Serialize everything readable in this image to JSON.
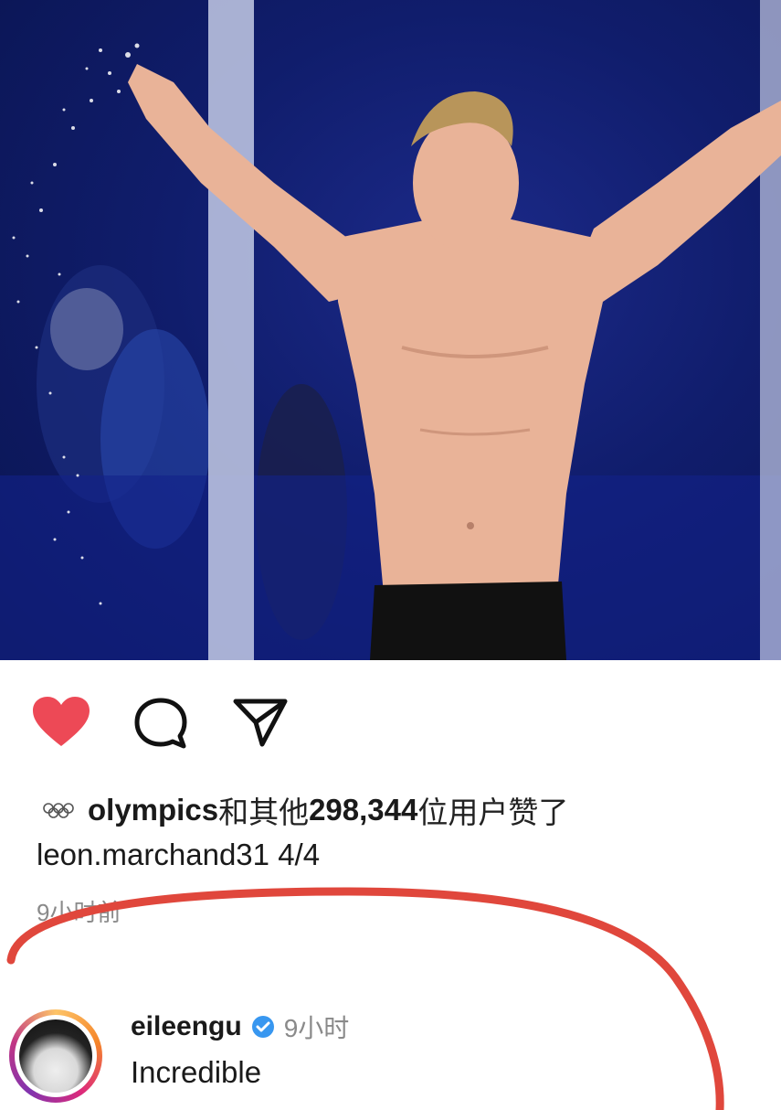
{
  "post": {
    "likes": {
      "liked_by_user": "olympics",
      "text_middle": "和其他",
      "count": "298,344",
      "text_suffix": "位用户赞了"
    },
    "caption": {
      "username": "leon.marchand31",
      "text": "4/4"
    },
    "time_ago": "9小时前",
    "actions": {
      "like_icon": "heart-filled-icon",
      "comment_icon": "comment-bubble-icon",
      "share_icon": "paper-plane-icon"
    }
  },
  "comment": {
    "username": "eileengu",
    "verified": true,
    "time": "9小时",
    "text": "Incredible"
  },
  "colors": {
    "like_red": "#ed4956",
    "verified_blue": "#3897f0",
    "annotation_red": "#e0473c",
    "photo_background": "#101d6c"
  }
}
